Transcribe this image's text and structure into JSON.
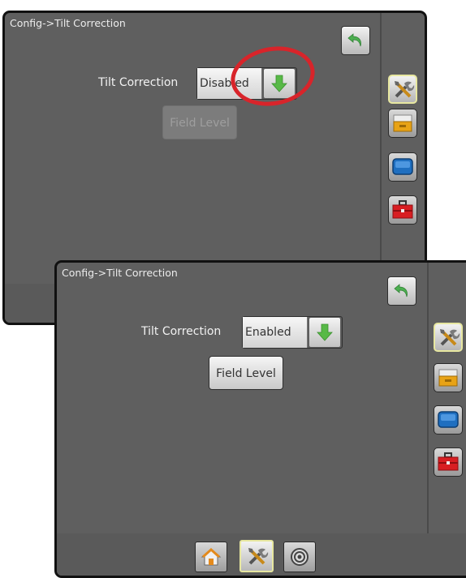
{
  "screen_disabled": {
    "title": "Config->Tilt Correction",
    "tilt_label": "Tilt Correction",
    "tilt_value": "Disabled",
    "field_level_label": "Field Level",
    "field_level_state": "disabled"
  },
  "screen_enabled": {
    "title": "Config->Tilt Correction",
    "tilt_label": "Tilt Correction",
    "tilt_value": "Enabled",
    "field_level_label": "Field Level",
    "field_level_state": "enabled"
  },
  "sidebar": {
    "items": [
      {
        "icon": "tools-icon",
        "selected": true
      },
      {
        "icon": "console-drawer-icon",
        "selected": false
      },
      {
        "icon": "display-icon",
        "selected": false
      },
      {
        "icon": "toolbox-icon",
        "selected": false
      }
    ]
  },
  "bottom_tabs": {
    "items": [
      {
        "icon": "home-icon",
        "selected": false
      },
      {
        "icon": "tools-icon",
        "selected": true
      },
      {
        "icon": "gnss-receiver-icon",
        "selected": false
      }
    ]
  },
  "colors": {
    "panel_bg": "#5f5f5f",
    "annotation_ring": "#d8242a",
    "arrow_green": "#58b947",
    "back_arrow_green": "#4caf50",
    "selected_border": "#e7e7a0"
  }
}
